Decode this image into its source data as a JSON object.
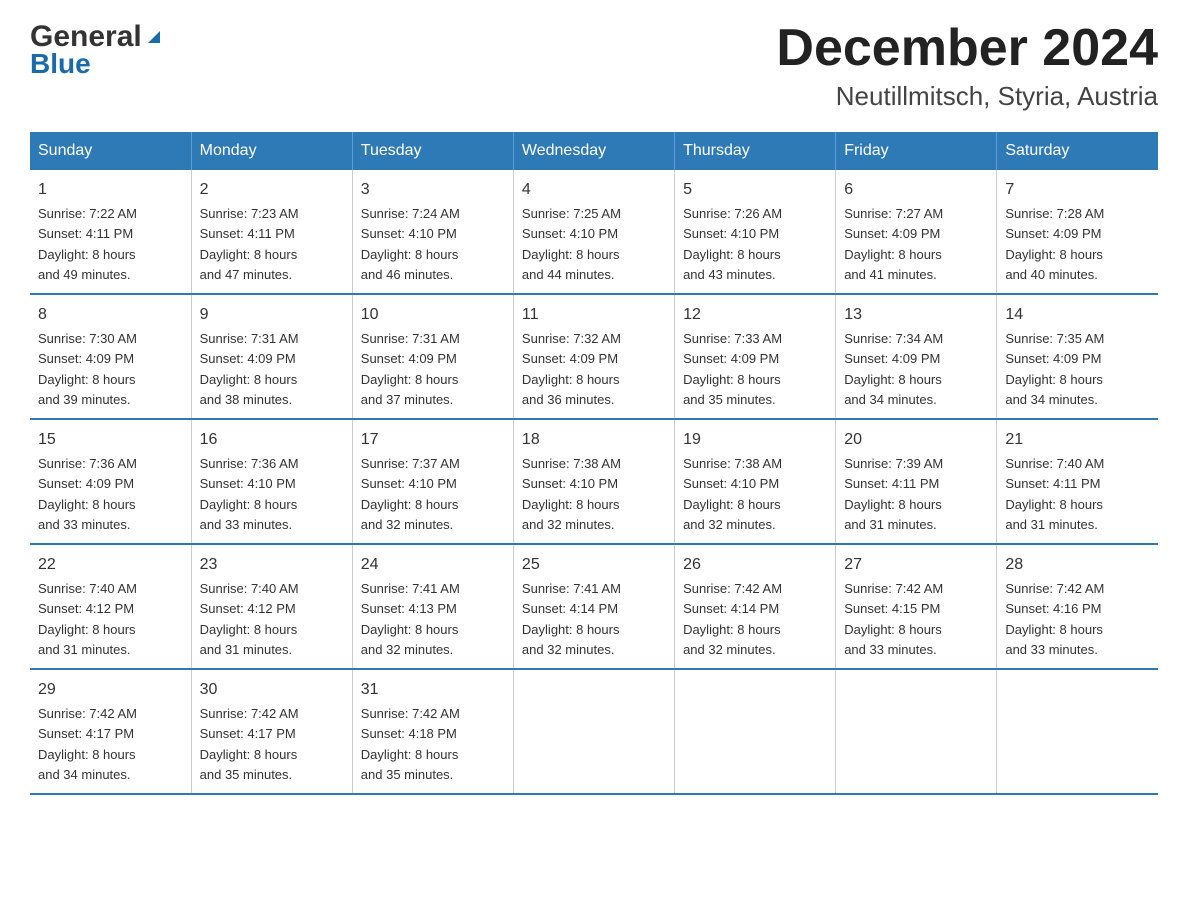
{
  "logo": {
    "general": "General",
    "blue": "Blue",
    "tagline": "Blue"
  },
  "title": "December 2024",
  "subtitle": "Neutillmitsch, Styria, Austria",
  "days_of_week": [
    "Sunday",
    "Monday",
    "Tuesday",
    "Wednesday",
    "Thursday",
    "Friday",
    "Saturday"
  ],
  "weeks": [
    [
      {
        "day": "1",
        "sunrise": "7:22 AM",
        "sunset": "4:11 PM",
        "daylight": "8 hours and 49 minutes."
      },
      {
        "day": "2",
        "sunrise": "7:23 AM",
        "sunset": "4:11 PM",
        "daylight": "8 hours and 47 minutes."
      },
      {
        "day": "3",
        "sunrise": "7:24 AM",
        "sunset": "4:10 PM",
        "daylight": "8 hours and 46 minutes."
      },
      {
        "day": "4",
        "sunrise": "7:25 AM",
        "sunset": "4:10 PM",
        "daylight": "8 hours and 44 minutes."
      },
      {
        "day": "5",
        "sunrise": "7:26 AM",
        "sunset": "4:10 PM",
        "daylight": "8 hours and 43 minutes."
      },
      {
        "day": "6",
        "sunrise": "7:27 AM",
        "sunset": "4:09 PM",
        "daylight": "8 hours and 41 minutes."
      },
      {
        "day": "7",
        "sunrise": "7:28 AM",
        "sunset": "4:09 PM",
        "daylight": "8 hours and 40 minutes."
      }
    ],
    [
      {
        "day": "8",
        "sunrise": "7:30 AM",
        "sunset": "4:09 PM",
        "daylight": "8 hours and 39 minutes."
      },
      {
        "day": "9",
        "sunrise": "7:31 AM",
        "sunset": "4:09 PM",
        "daylight": "8 hours and 38 minutes."
      },
      {
        "day": "10",
        "sunrise": "7:31 AM",
        "sunset": "4:09 PM",
        "daylight": "8 hours and 37 minutes."
      },
      {
        "day": "11",
        "sunrise": "7:32 AM",
        "sunset": "4:09 PM",
        "daylight": "8 hours and 36 minutes."
      },
      {
        "day": "12",
        "sunrise": "7:33 AM",
        "sunset": "4:09 PM",
        "daylight": "8 hours and 35 minutes."
      },
      {
        "day": "13",
        "sunrise": "7:34 AM",
        "sunset": "4:09 PM",
        "daylight": "8 hours and 34 minutes."
      },
      {
        "day": "14",
        "sunrise": "7:35 AM",
        "sunset": "4:09 PM",
        "daylight": "8 hours and 34 minutes."
      }
    ],
    [
      {
        "day": "15",
        "sunrise": "7:36 AM",
        "sunset": "4:09 PM",
        "daylight": "8 hours and 33 minutes."
      },
      {
        "day": "16",
        "sunrise": "7:36 AM",
        "sunset": "4:10 PM",
        "daylight": "8 hours and 33 minutes."
      },
      {
        "day": "17",
        "sunrise": "7:37 AM",
        "sunset": "4:10 PM",
        "daylight": "8 hours and 32 minutes."
      },
      {
        "day": "18",
        "sunrise": "7:38 AM",
        "sunset": "4:10 PM",
        "daylight": "8 hours and 32 minutes."
      },
      {
        "day": "19",
        "sunrise": "7:38 AM",
        "sunset": "4:10 PM",
        "daylight": "8 hours and 32 minutes."
      },
      {
        "day": "20",
        "sunrise": "7:39 AM",
        "sunset": "4:11 PM",
        "daylight": "8 hours and 31 minutes."
      },
      {
        "day": "21",
        "sunrise": "7:40 AM",
        "sunset": "4:11 PM",
        "daylight": "8 hours and 31 minutes."
      }
    ],
    [
      {
        "day": "22",
        "sunrise": "7:40 AM",
        "sunset": "4:12 PM",
        "daylight": "8 hours and 31 minutes."
      },
      {
        "day": "23",
        "sunrise": "7:40 AM",
        "sunset": "4:12 PM",
        "daylight": "8 hours and 31 minutes."
      },
      {
        "day": "24",
        "sunrise": "7:41 AM",
        "sunset": "4:13 PM",
        "daylight": "8 hours and 32 minutes."
      },
      {
        "day": "25",
        "sunrise": "7:41 AM",
        "sunset": "4:14 PM",
        "daylight": "8 hours and 32 minutes."
      },
      {
        "day": "26",
        "sunrise": "7:42 AM",
        "sunset": "4:14 PM",
        "daylight": "8 hours and 32 minutes."
      },
      {
        "day": "27",
        "sunrise": "7:42 AM",
        "sunset": "4:15 PM",
        "daylight": "8 hours and 33 minutes."
      },
      {
        "day": "28",
        "sunrise": "7:42 AM",
        "sunset": "4:16 PM",
        "daylight": "8 hours and 33 minutes."
      }
    ],
    [
      {
        "day": "29",
        "sunrise": "7:42 AM",
        "sunset": "4:17 PM",
        "daylight": "8 hours and 34 minutes."
      },
      {
        "day": "30",
        "sunrise": "7:42 AM",
        "sunset": "4:17 PM",
        "daylight": "8 hours and 35 minutes."
      },
      {
        "day": "31",
        "sunrise": "7:42 AM",
        "sunset": "4:18 PM",
        "daylight": "8 hours and 35 minutes."
      },
      null,
      null,
      null,
      null
    ]
  ],
  "labels": {
    "sunrise": "Sunrise:",
    "sunset": "Sunset:",
    "daylight": "Daylight:"
  }
}
